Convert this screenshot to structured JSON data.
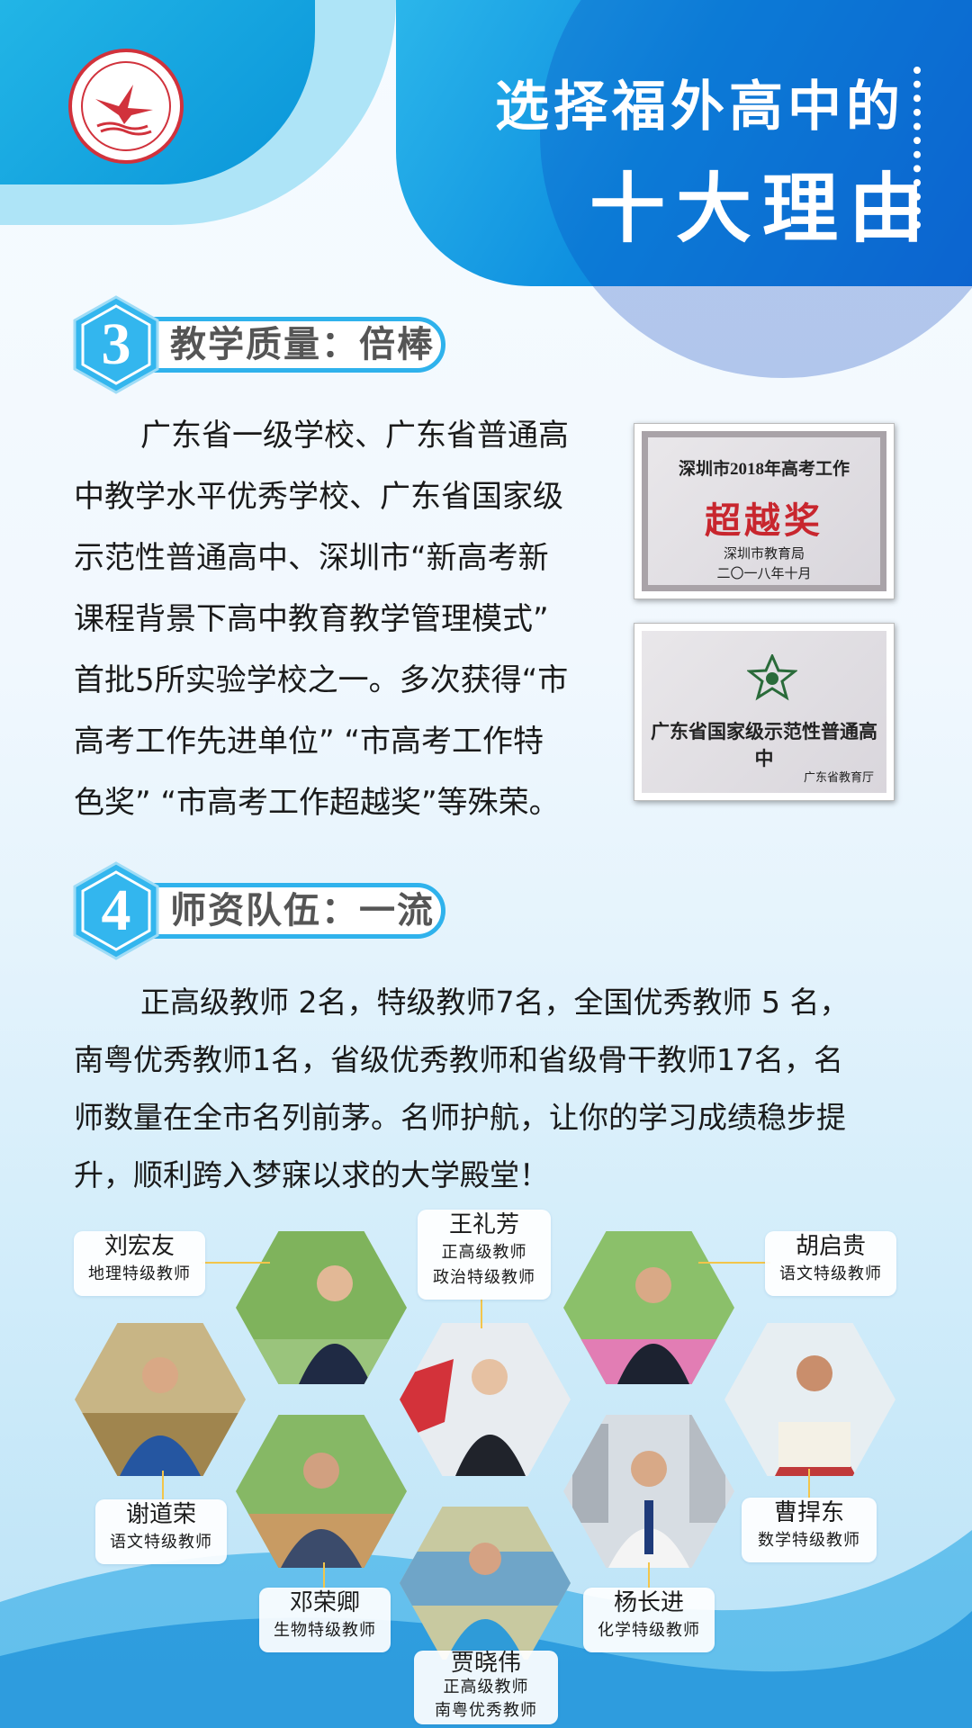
{
  "header": {
    "title_line1": "选择福外高中的",
    "title_line2": "十大理由"
  },
  "section3": {
    "number": "3",
    "title": "教学质量：倍棒",
    "lines": [
      "广东省一级学校、广东省普通高",
      "中教学水平优秀学校、广东省国家级",
      "示范性普通高中、深圳市“新高考新",
      "课程背景下高中教育教学管理模式”",
      "首批5所实验学校之一。多次获得“市",
      "高考工作先进单位” “市高考工作特",
      "色奖” “市高考工作超越奖”等殊荣。"
    ],
    "cert1": {
      "line1": "深圳市2018年高考工作",
      "award": "超越奖",
      "issuer": "深圳市教育局",
      "date": "二〇一八年十月"
    },
    "cert2": {
      "title": "广东省国家级示范性普通高中",
      "issuer": "广东省教育厅"
    }
  },
  "section4": {
    "number": "4",
    "title": "师资队伍：一流",
    "lines": [
      "正高级教师 2名，特级教师7名，全国优秀教师  5  名，",
      "南粤优秀教师1名，省级优秀教师和省级骨干教师17名，名",
      "师数量在全市名列前茅。名师护航，让你的学习成绩稳步提",
      "升，顺利跨入梦寐以求的大学殿堂！"
    ]
  },
  "teachers": [
    {
      "name": "刘宏友",
      "titles": [
        "地理特级教师"
      ]
    },
    {
      "name": "王礼芳",
      "titles": [
        "正高级教师",
        "政治特级教师"
      ]
    },
    {
      "name": "胡启贵",
      "titles": [
        "语文特级教师"
      ]
    },
    {
      "name": "谢道荣",
      "titles": [
        "语文特级教师"
      ]
    },
    {
      "name": "曹捍东",
      "titles": [
        "数学特级教师"
      ]
    },
    {
      "name": "邓荣卿",
      "titles": [
        "生物特级教师"
      ]
    },
    {
      "name": "杨长进",
      "titles": [
        "化学特级教师"
      ]
    },
    {
      "name": "贾晓伟",
      "titles": [
        "正高级教师",
        "南粤优秀教师"
      ]
    }
  ],
  "colors": {
    "accent_blue": "#2fb2ec",
    "header_blue": "#0f90e0",
    "award_red": "#c8262e",
    "logo_red": "#d1323c",
    "connector_gold": "#f3c54a"
  }
}
